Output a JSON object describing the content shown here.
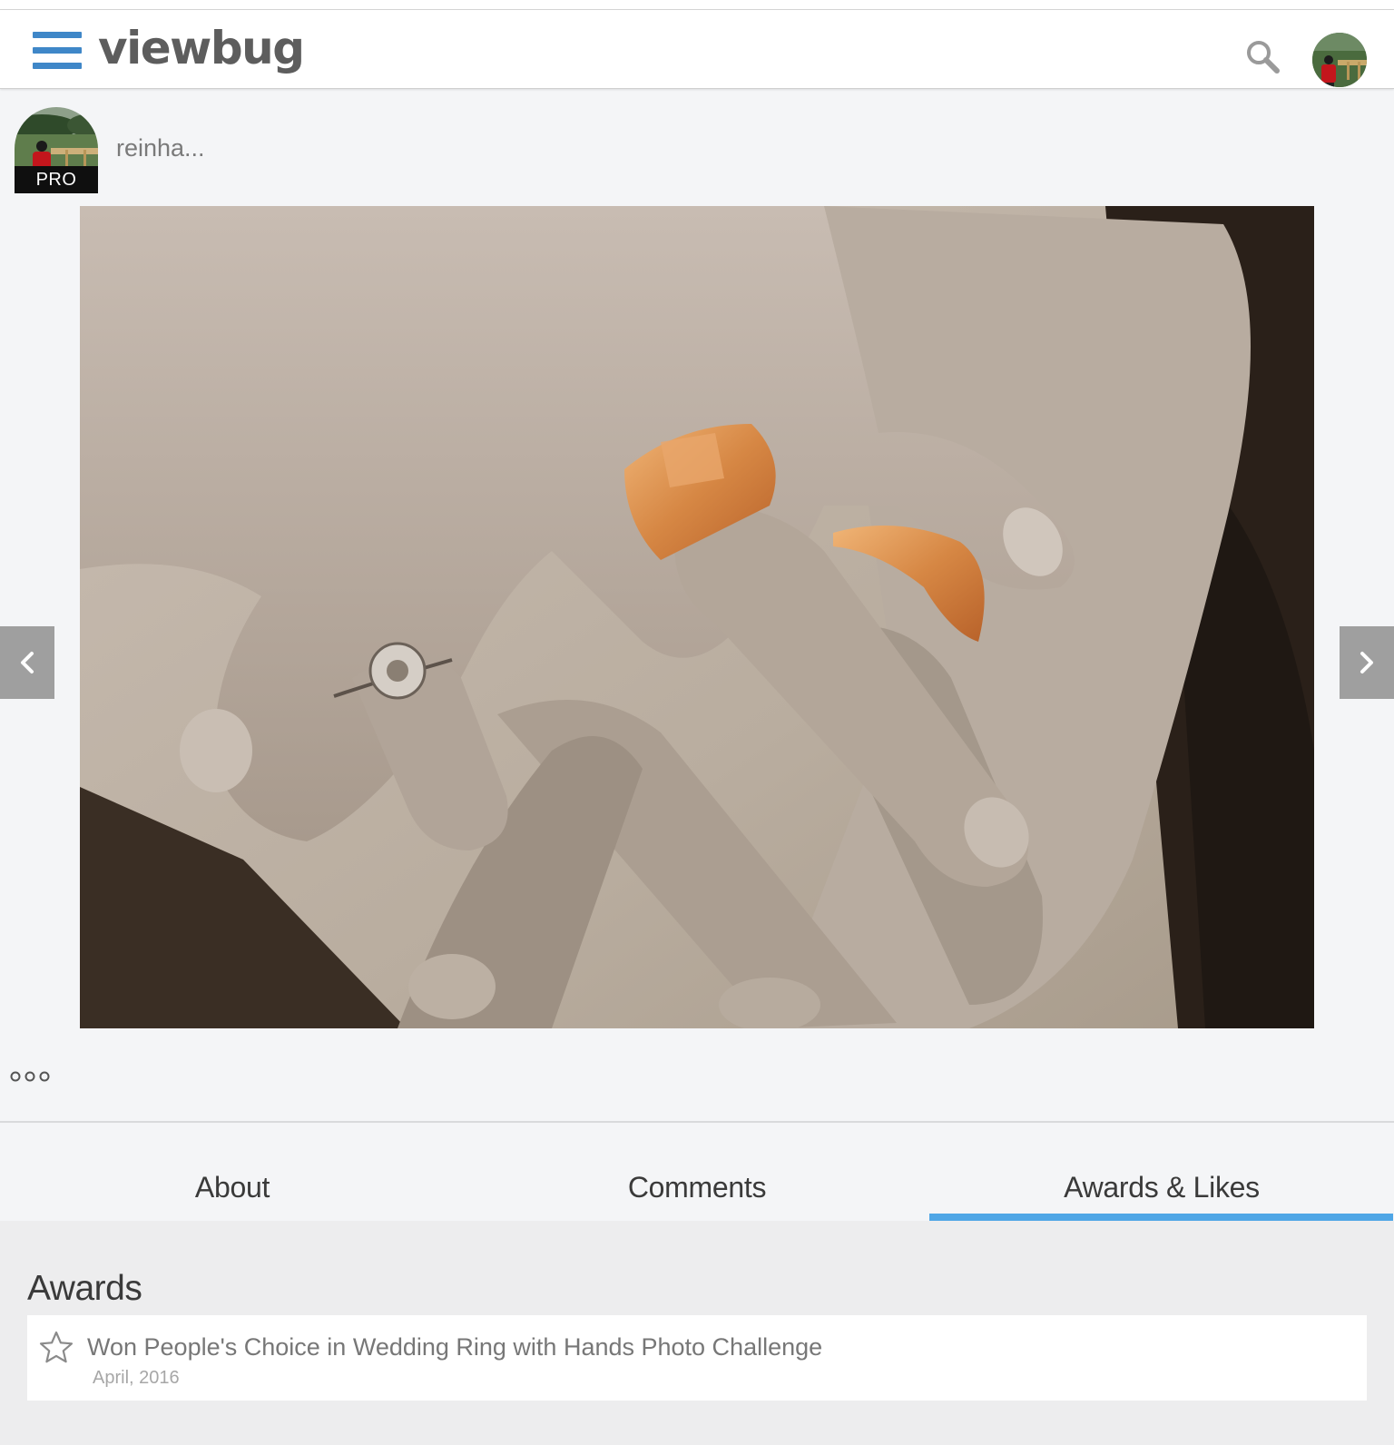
{
  "header": {
    "logo": "viewbug",
    "menu_icon": "hamburger-menu-icon",
    "search_icon": "search-icon",
    "brand_color": "#3f87c8"
  },
  "author": {
    "name": "reinha...",
    "badge": "PRO"
  },
  "photo": {
    "alt": "Wedding rings on intertwined hands"
  },
  "tabs": [
    {
      "label": "About",
      "active": false
    },
    {
      "label": "Comments",
      "active": false
    },
    {
      "label": "Awards & Likes",
      "active": true
    }
  ],
  "tab_accent_color": "#4fa6e6",
  "awards": {
    "heading": "Awards",
    "items": [
      {
        "title": "Won People's Choice in Wedding Ring with Hands Photo Challenge",
        "date": "April, 2016",
        "icon": "star-icon"
      }
    ]
  }
}
